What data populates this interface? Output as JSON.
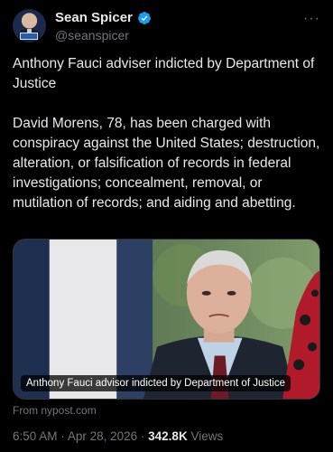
{
  "author": {
    "display_name": "Sean Spicer",
    "handle": "@seanspicer",
    "verified_badge_icon": "verified-badge-icon",
    "accent_color": "#1d9bf0"
  },
  "more_icon": "more-horizontal-icon",
  "tweet": {
    "headline": "Anthony Fauci adviser indicted by Department of Justice",
    "body": "David Morens, 78, has been charged with conspiracy against the United States; destruction, alteration, or falsification of records in federal investigations; concealment, removal, or mutilation of records; and aiding and abetting."
  },
  "media": {
    "caption": "Anthony Fauci advisor indicted by Department of Justice"
  },
  "link_source": "From nypost.com",
  "meta": {
    "time": "6:50 AM",
    "separator": "·",
    "date": "Apr 28, 2026",
    "views_count": "342.8K",
    "views_label": "Views"
  }
}
